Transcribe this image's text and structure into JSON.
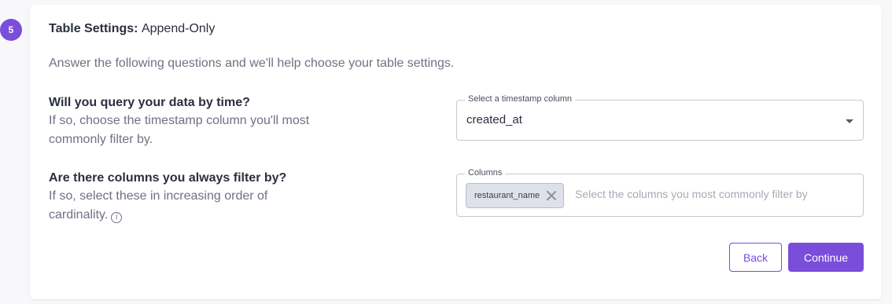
{
  "step": {
    "number": "5"
  },
  "header": {
    "title_prefix": "Table Settings:",
    "title_mode": "Append-Only"
  },
  "intro": "Answer the following questions and we'll help choose your table settings.",
  "questions": [
    {
      "title": "Will you query your data by time?",
      "help": "If so, choose the timestamp column you'll most commonly filter by."
    },
    {
      "title": "Are there columns you always filter by?",
      "help": "If so, select these in increasing order of cardinality."
    }
  ],
  "timestamp_select": {
    "label": "Select a timestamp column",
    "value": "created_at"
  },
  "columns_select": {
    "label": "Columns",
    "chips": [
      "restaurant_name"
    ],
    "placeholder": "Select the columns you most commonly filter by"
  },
  "actions": {
    "back": "Back",
    "continue": "Continue"
  },
  "colors": {
    "accent": "#7a4ddb",
    "chip_bg": "#dfe1ea"
  },
  "icons": {
    "info": "info-circle-icon",
    "remove": "close-icon",
    "dropdown": "caret-down-icon"
  }
}
